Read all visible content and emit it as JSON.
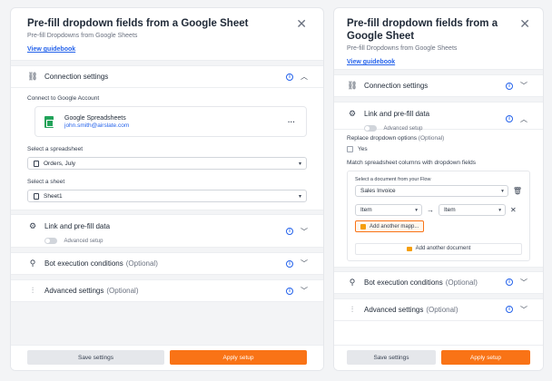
{
  "left": {
    "title": "Pre-fill dropdown fields from a Google Sheet",
    "subtitle": "Pre-fill Dropdowns from Google Sheets",
    "guide": "View guidebook",
    "connection": {
      "label": "Connection settings",
      "connect_label": "Connect to Google Account",
      "account_title": "Google Spreadsheets",
      "account_email": "john.smith@airslate.com",
      "spreadsheet_label": "Select a spreadsheet",
      "spreadsheet_value": "Orders, July",
      "sheet_label": "Select a sheet",
      "sheet_value": "Sheet1"
    },
    "link": {
      "label": "Link and pre-fill data",
      "toggle_label": "Advanced setup"
    },
    "bot": {
      "label": "Bot execution conditions",
      "optional": "(Optional)"
    },
    "advanced": {
      "label": "Advanced settings",
      "optional": "(Optional)"
    },
    "save": "Save settings",
    "apply": "Apply setup"
  },
  "right": {
    "title": "Pre-fill dropdown fields from a Google Sheet",
    "subtitle": "Pre-fill Dropdowns from Google Sheets",
    "guide": "View guidebook",
    "connection": {
      "label": "Connection settings"
    },
    "link": {
      "label": "Link and pre-fill data",
      "toggle_label": "Advanced setup",
      "replace_label": "Replace dropdown options",
      "replace_optional": "(Optional)",
      "yes": "Yes",
      "match_label": "Match spreadsheet columns with dropdown fields",
      "doc_label": "Select a document from your Flow",
      "doc_value": "Sales Invoice",
      "from_value": "Item",
      "to_value": "Item",
      "add_mapping": "Add another mapp...",
      "add_document": "Add another document"
    },
    "bot": {
      "label": "Bot execution conditions",
      "optional": "(Optional)"
    },
    "advanced": {
      "label": "Advanced settings",
      "optional": "(Optional)"
    },
    "save": "Save settings",
    "apply": "Apply setup"
  },
  "icons": {
    "info": "info-circle-icon",
    "link": "link-icon",
    "gear": "gear-icon",
    "bot": "bot-icon",
    "sliders": "sliders-icon",
    "trash": "trash-icon"
  },
  "colors": {
    "accent": "#f97316",
    "link": "#2563eb",
    "sheets": "#22a35a"
  }
}
